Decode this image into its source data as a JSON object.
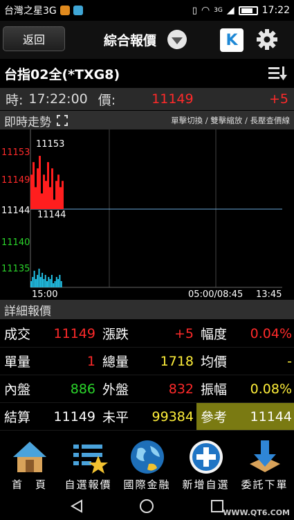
{
  "status": {
    "carrier": "台灣之星3G",
    "network": "3G",
    "time": "17:22"
  },
  "header": {
    "back_label": "返回",
    "title": "綜合報價",
    "k_label": "K"
  },
  "symbol": {
    "name": "台指02全(*TXG8)"
  },
  "quote": {
    "time_label": "時:",
    "time": "17:22:00",
    "price_label": "價:",
    "price": "11149",
    "change": "+5"
  },
  "realtime": {
    "title": "即時走勢",
    "hint": "單擊切換 / 雙擊縮放 / 長壓查價線"
  },
  "chart_data": {
    "type": "line",
    "y_ticks": [
      "11153",
      "11149",
      "11144",
      "11140",
      "11135"
    ],
    "price_labels": {
      "high": "11153",
      "ref": "11144"
    },
    "x_labels": [
      "15:00",
      "05:00/08:45",
      "13:45"
    ],
    "price_series": [
      11150,
      11152,
      11148,
      11151,
      11153,
      11147,
      11150,
      11149,
      11152,
      11148,
      11151,
      11146,
      11149,
      11150,
      11148,
      11149
    ],
    "volume_series": [
      3,
      5,
      8,
      4,
      6,
      9,
      5,
      7,
      4,
      6,
      3,
      5,
      4,
      6,
      2,
      3,
      5,
      4,
      6,
      3
    ],
    "colors": {
      "up": "#ff1e1e",
      "down": "#22c2e8",
      "ref_line": "#6aa8d8",
      "grid": "#444444"
    }
  },
  "details": {
    "title": "詳細報價",
    "rows": [
      [
        {
          "label": "成交",
          "value": "11149",
          "color": "red"
        },
        {
          "label": "漲跌",
          "value": "+5",
          "color": "red"
        },
        {
          "label": "幅度",
          "value": "0.04%",
          "color": "red"
        }
      ],
      [
        {
          "label": "單量",
          "value": "1",
          "color": "red"
        },
        {
          "label": "總量",
          "value": "1718",
          "color": "yellow"
        },
        {
          "label": "均價",
          "value": "-",
          "color": "yellow"
        }
      ],
      [
        {
          "label": "內盤",
          "value": "886",
          "color": "green"
        },
        {
          "label": "外盤",
          "value": "832",
          "color": "red"
        },
        {
          "label": "振幅",
          "value": "0.08%",
          "color": "yellow"
        }
      ],
      [
        {
          "label": "結算",
          "value": "11149",
          "color": "white"
        },
        {
          "label": "未平",
          "value": "99384",
          "color": "yellow"
        },
        {
          "label": "參考",
          "value": "11144",
          "color": "white"
        }
      ]
    ]
  },
  "nav": [
    {
      "label": "首　頁",
      "icon": "home-icon"
    },
    {
      "label": "自選報價",
      "icon": "watchlist-icon"
    },
    {
      "label": "國際金融",
      "icon": "globe-icon"
    },
    {
      "label": "新增自選",
      "icon": "add-icon"
    },
    {
      "label": "委託下單",
      "icon": "order-icon"
    }
  ],
  "watermark": "WWW.QT6.COM"
}
